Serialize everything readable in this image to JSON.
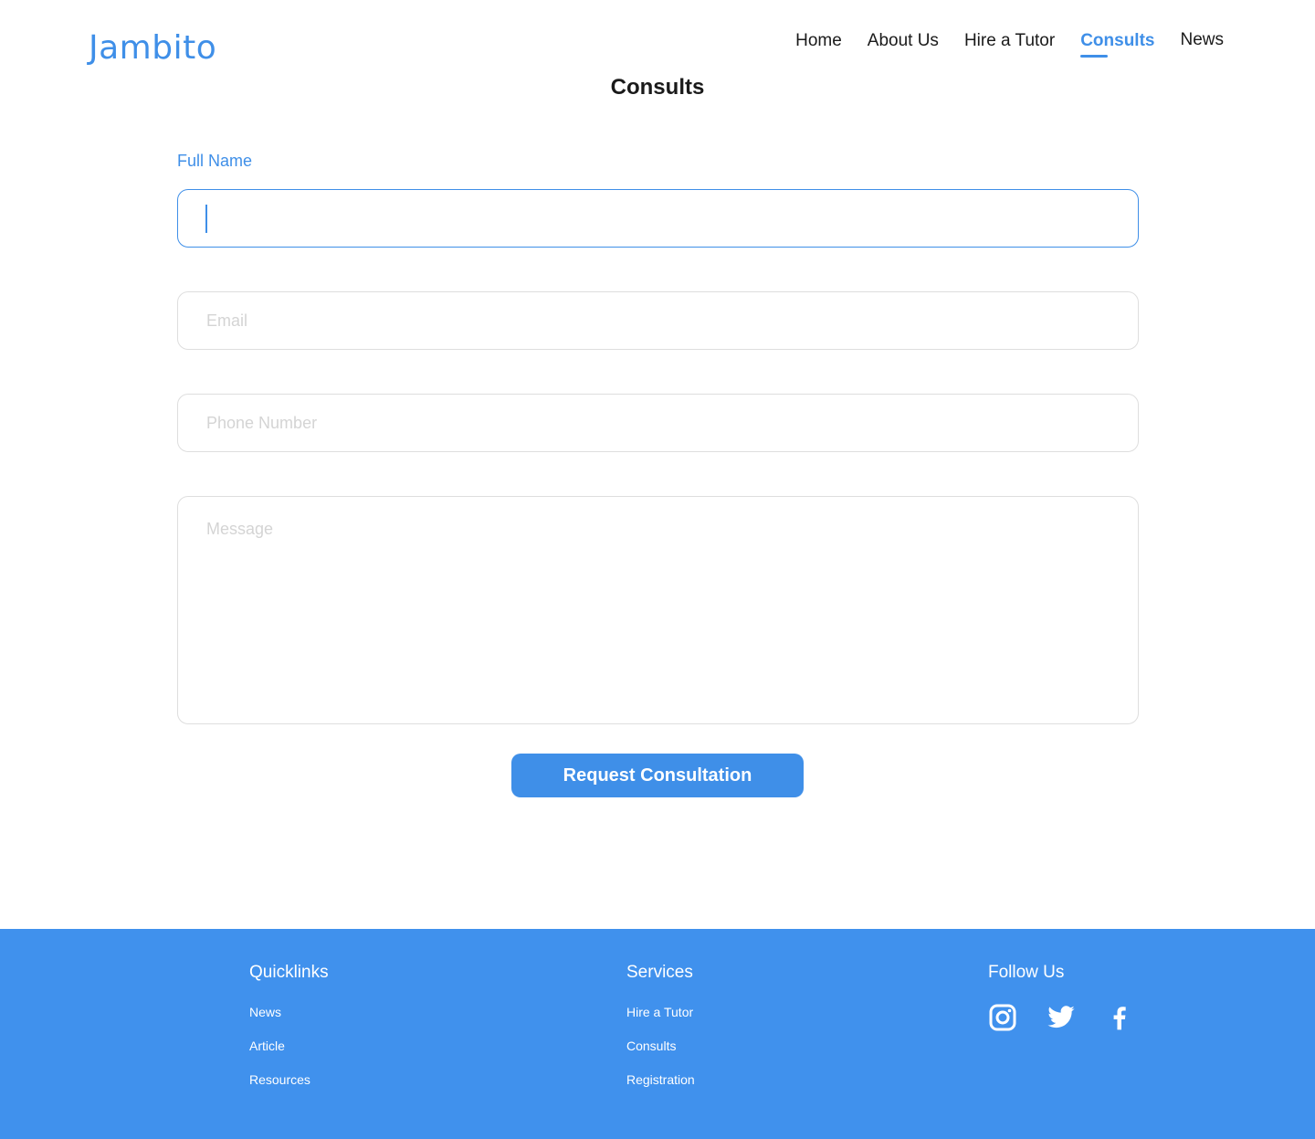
{
  "brand": {
    "logo_text": "Jambito",
    "accent_color": "#3f8fe8"
  },
  "nav": {
    "items": [
      {
        "label": "Home",
        "active": false
      },
      {
        "label": "About Us",
        "active": false
      },
      {
        "label": "Hire a Tutor",
        "active": false
      },
      {
        "label": "Consults",
        "active": true
      },
      {
        "label": "News",
        "active": false
      }
    ]
  },
  "page": {
    "title": "Consults"
  },
  "form": {
    "full_name": {
      "label": "Full Name",
      "value": "",
      "focused": true
    },
    "email": {
      "placeholder": "Email",
      "value": ""
    },
    "phone": {
      "placeholder": "Phone Number",
      "value": ""
    },
    "message": {
      "placeholder": "Message",
      "value": ""
    },
    "submit_label": "Request Consultation"
  },
  "footer": {
    "background_color": "#4091ed",
    "quicklinks": {
      "title": "Quicklinks",
      "links": [
        "News",
        "Article",
        "Resources"
      ]
    },
    "services": {
      "title": "Services",
      "links": [
        "Hire a Tutor",
        "Consults",
        "Registration"
      ]
    },
    "follow": {
      "title": "Follow Us",
      "icons": [
        "instagram-icon",
        "twitter-icon",
        "facebook-icon"
      ]
    }
  }
}
